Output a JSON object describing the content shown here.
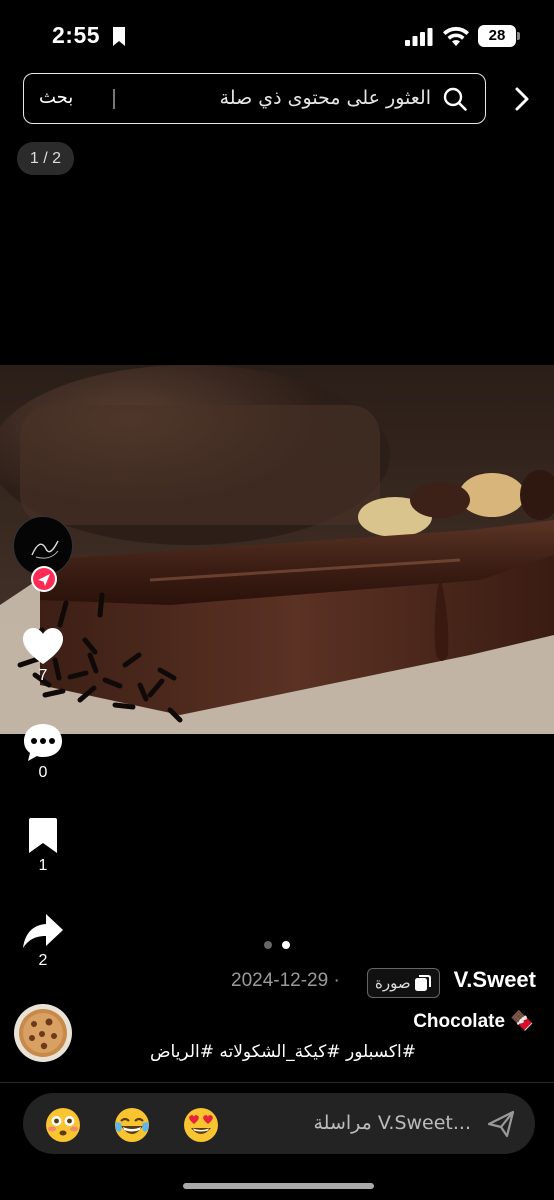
{
  "status_bar": {
    "time": "2:55",
    "battery": "28"
  },
  "search": {
    "placeholder": "العثور على محتوى ذي صلة",
    "button_label": "بحث"
  },
  "media": {
    "page_counter": "1 / 2",
    "current_slide": 2,
    "total_slides": 2
  },
  "actions": {
    "likes": "7",
    "comments": "0",
    "saves": "1",
    "shares": "2"
  },
  "post": {
    "author": "V.Sweet",
    "type_label": "صورة",
    "date": "2024-12-29 ·",
    "caption_title": "Chocolate 🍫",
    "hashtags": "#اكسبلور #كيكة_الشكولاته #الرياض"
  },
  "message_bar": {
    "placeholder": "مراسلة V.Sweet...",
    "emojis": [
      "😳",
      "😂",
      "😍"
    ]
  },
  "colors": {
    "accent_red": "#fe2c55",
    "background": "#000000"
  }
}
